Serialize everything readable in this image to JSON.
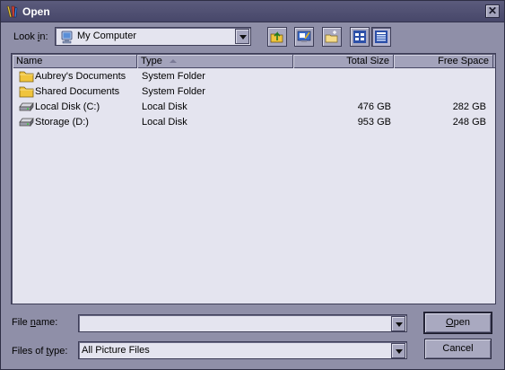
{
  "window": {
    "title": "Open",
    "close_glyph": "✕"
  },
  "look_in": {
    "label_pre": "Look ",
    "label_accel": "i",
    "label_post": "n:",
    "value": "My Computer",
    "icon": "my-computer-icon"
  },
  "toolbar": {
    "buttons": [
      {
        "name": "up-one-level",
        "icon": "up-folder-icon"
      },
      {
        "name": "desktop",
        "icon": "desktop-icon"
      },
      {
        "name": "create-new-folder",
        "icon": "new-folder-icon"
      },
      {
        "name": "list-view",
        "icon": "list-view-icon"
      },
      {
        "name": "details-view",
        "icon": "details-view-icon"
      }
    ]
  },
  "list": {
    "columns": [
      "Name",
      "Type",
      "Total Size",
      "Free Space"
    ],
    "sorted_by": "Type",
    "rows": [
      {
        "name": "Aubrey's Documents",
        "type": "System Folder",
        "total": "",
        "free": "",
        "icon": "folder-icon"
      },
      {
        "name": "Shared Documents",
        "type": "System Folder",
        "total": "",
        "free": "",
        "icon": "folder-icon"
      },
      {
        "name": "Local Disk (C:)",
        "type": "Local Disk",
        "total": "476 GB",
        "free": "282 GB",
        "icon": "drive-icon"
      },
      {
        "name": "Storage (D:)",
        "type": "Local Disk",
        "total": "953 GB",
        "free": "248 GB",
        "icon": "drive-icon"
      }
    ]
  },
  "file_name": {
    "label_pre": "File ",
    "label_accel": "n",
    "label_post": "ame:",
    "value": ""
  },
  "file_type": {
    "label_pre": "Files of ",
    "label_accel": "t",
    "label_post": "ype:",
    "value": "All Picture Files"
  },
  "buttons": {
    "open_accel": "O",
    "open_rest": "pen",
    "cancel": "Cancel"
  },
  "colors": {
    "dialog_bg": "#8f8fa8",
    "titlebar": "#4f4f72",
    "list_bg": "#e4e4ef",
    "folder": "#f0c43c"
  }
}
